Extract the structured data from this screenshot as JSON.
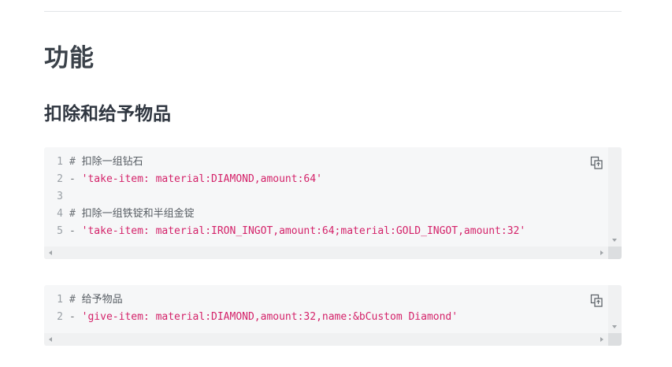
{
  "section": {
    "title": "功能"
  },
  "subsection": {
    "title": "扣除和给予物品"
  },
  "code_blocks": [
    {
      "lines": [
        {
          "num": "1",
          "comment_mark": "#",
          "comment": "扣除一组钻石"
        },
        {
          "num": "2",
          "dash": "-",
          "string": "'take-item: material:DIAMOND,amount:64'"
        },
        {
          "num": "3"
        },
        {
          "num": "4",
          "comment_mark": "#",
          "comment": "扣除一组铁锭和半组金锭"
        },
        {
          "num": "5",
          "dash": "-",
          "string": "'take-item: material:IRON_INGOT,amount:64;material:GOLD_INGOT,amount:32'"
        }
      ],
      "copy_icon": "copy-icon"
    },
    {
      "lines": [
        {
          "num": "1",
          "comment_mark": "#",
          "comment": "给予物品"
        },
        {
          "num": "2",
          "dash": "-",
          "string": "'give-item: material:DIAMOND,amount:32,name:&bCustom Diamond'"
        }
      ],
      "copy_icon": "copy-icon"
    }
  ],
  "colors": {
    "string": "#d4236a",
    "code_background": "#f6f7f8",
    "heading": "#3a4149"
  }
}
